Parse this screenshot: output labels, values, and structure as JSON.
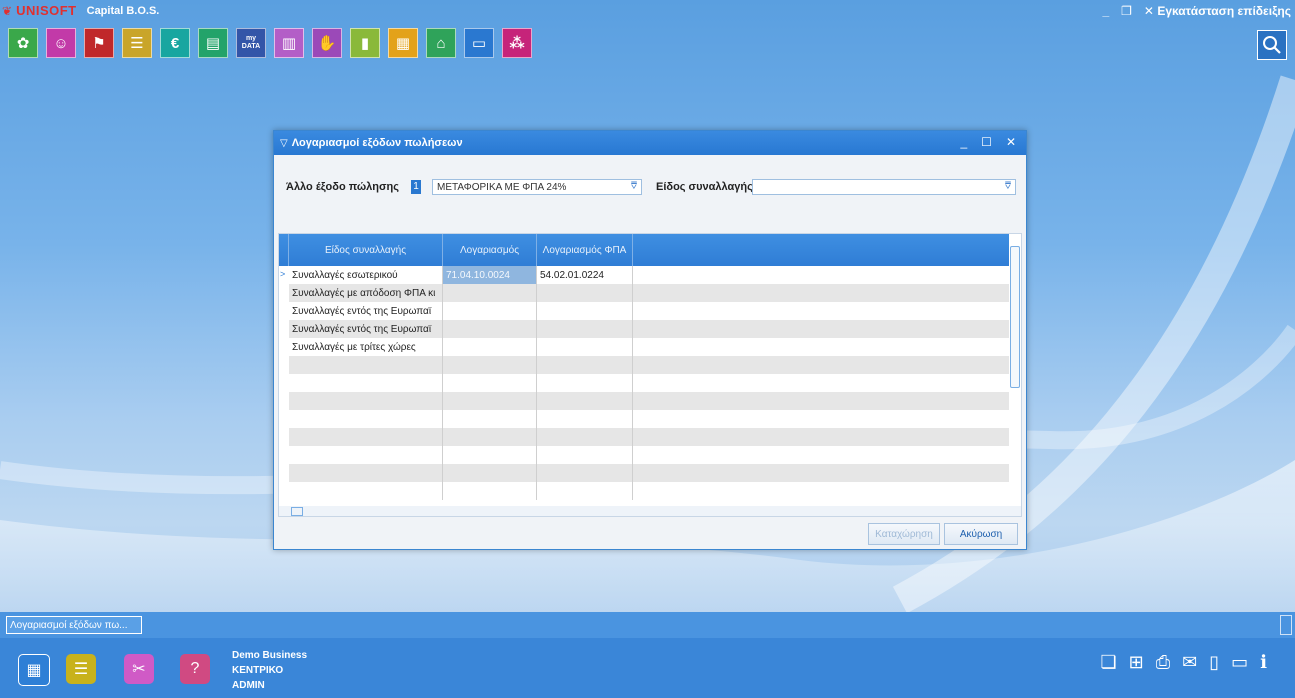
{
  "app": {
    "logo": "UNISOFT",
    "subtitle": "Capital B.O.S.",
    "window_controls": {
      "minimize": "_",
      "restore": "❐",
      "close": "✕",
      "title": "Εγκατάσταση επίδειξης"
    }
  },
  "toolbar_apps": [
    {
      "icon": "gear-flower-icon",
      "color": "#3aa84a"
    },
    {
      "icon": "people-icon",
      "color": "#c23aa8"
    },
    {
      "icon": "tag-icon",
      "color": "#c0282a"
    },
    {
      "icon": "document-lines-icon",
      "color": "#c9a52a"
    },
    {
      "icon": "euro-icon",
      "color": "#18a6a0"
    },
    {
      "icon": "ledger-icon",
      "color": "#23a36a"
    },
    {
      "icon": "mydata-icon",
      "color": "#3355a8",
      "label": "my DATA"
    },
    {
      "icon": "factory-icon",
      "color": "#b35ec7"
    },
    {
      "icon": "handshake-icon",
      "color": "#9b49b8"
    },
    {
      "icon": "abc-chart-icon",
      "color": "#8ab93a"
    },
    {
      "icon": "report-icon",
      "color": "#e3a21a"
    },
    {
      "icon": "org-chart-icon",
      "color": "#2fa35a"
    },
    {
      "icon": "window-icon",
      "color": "#2a78d0"
    },
    {
      "icon": "settings-grid-icon",
      "color": "#c6247a"
    }
  ],
  "dialog": {
    "title": "Λογαριασμοί εξόδων πωλήσεων",
    "filter": {
      "label_other": "Άλλο έξοδο πώλησης",
      "code": "1",
      "selected_value": "ΜΕΤΑΦΟΡΙΚΑ ΜΕ ΦΠΑ 24%",
      "label_type": "Είδος συναλλαγής",
      "type_value": ""
    },
    "grid": {
      "columns": [
        "Είδος συναλλαγής",
        "Λογαριασμός",
        "Λογαριασμός ΦΠΑ"
      ],
      "rows": [
        [
          "Συναλλαγές εσωτερικού",
          "71.04.10.0024",
          "54.02.01.0224"
        ],
        [
          "Συναλλαγές με απόδοση ΦΠΑ κι",
          "",
          ""
        ],
        [
          "Συναλλαγές εντός της Ευρωπαϊ",
          "",
          ""
        ],
        [
          "Συναλλαγές εντός της Ευρωπαϊ",
          "",
          ""
        ],
        [
          "Συναλλαγές με τρίτες χώρες",
          "",
          ""
        ]
      ],
      "empty_rows": 8
    },
    "buttons": {
      "submit": "Καταχώρηση",
      "cancel": "Ακύρωση"
    }
  },
  "taskbar": {
    "open_window": "Λογαριασμοί εξόδων πω..."
  },
  "footer": {
    "company": "Demo Business",
    "branch": "ΚΕΝΤΡΙΚΟ",
    "user": "ADMIN",
    "icons": [
      "grid-icon",
      "ledger-icon",
      "tools-icon",
      "help-icon"
    ],
    "tools": [
      "copy-icon",
      "grid-icon",
      "print-icon",
      "mail-icon",
      "document-icon",
      "window-icon",
      "info-icon"
    ]
  },
  "colors": {
    "brand_red": "#e03030",
    "accent": "#2f7dd5",
    "selected_cell": "#8fb6df"
  }
}
